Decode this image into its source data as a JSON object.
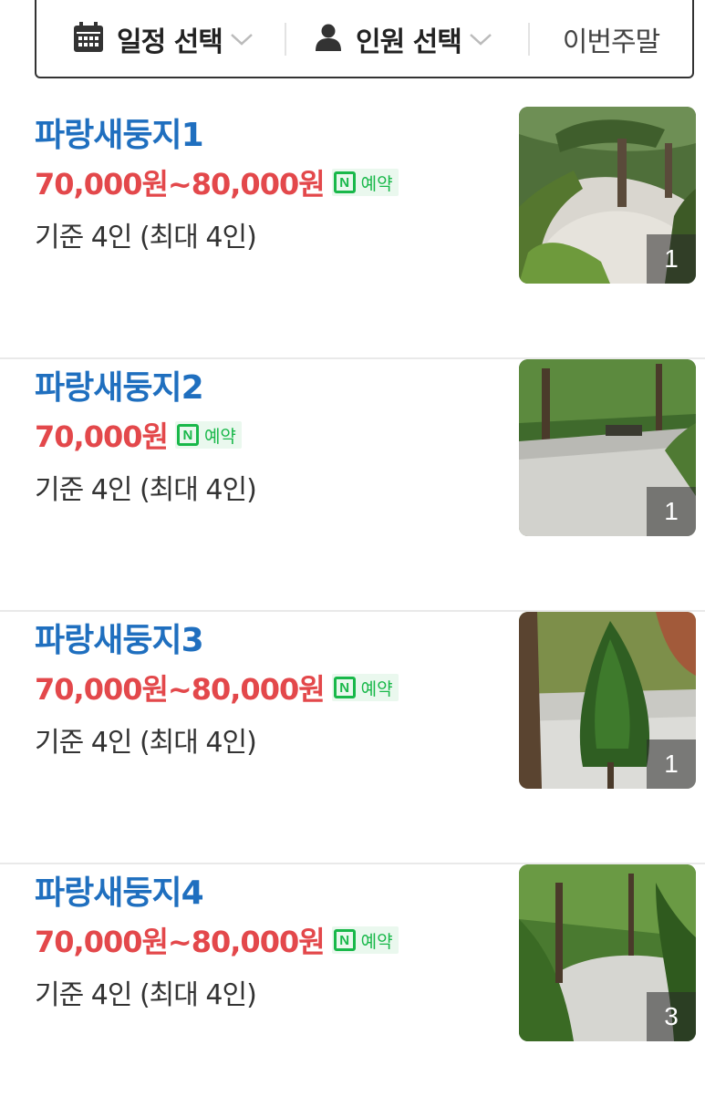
{
  "filter_bar": {
    "date_label": "일정 선택",
    "people_label": "인원 선택",
    "weekend_label": "이번주말"
  },
  "listings": [
    {
      "name": "파랑새둥지1",
      "price": "70,000원~80,000원",
      "reserve_label": "예약",
      "capacity": "기준 4인 (최대 4인)",
      "photo_count": "1"
    },
    {
      "name": "파랑새둥지2",
      "price": "70,000원",
      "reserve_label": "예약",
      "capacity": "기준 4인 (최대 4인)",
      "photo_count": "1"
    },
    {
      "name": "파랑새둥지3",
      "price": "70,000원~80,000원",
      "reserve_label": "예약",
      "capacity": "기준 4인 (최대 4인)",
      "photo_count": "1"
    },
    {
      "name": "파랑새둥지4",
      "price": "70,000원~80,000원",
      "reserve_label": "예약",
      "capacity": "기준 4인 (최대 4인)",
      "photo_count": "3"
    }
  ],
  "badge_letter": "N",
  "icons": {
    "date": "calendar-icon",
    "people": "person-icon",
    "dropdown": "chevron-down-icon",
    "reserve": "naver-booking-icon"
  },
  "colors": {
    "name": "#1f6fbf",
    "price": "#e3484b",
    "naver_green": "#19b84a"
  }
}
